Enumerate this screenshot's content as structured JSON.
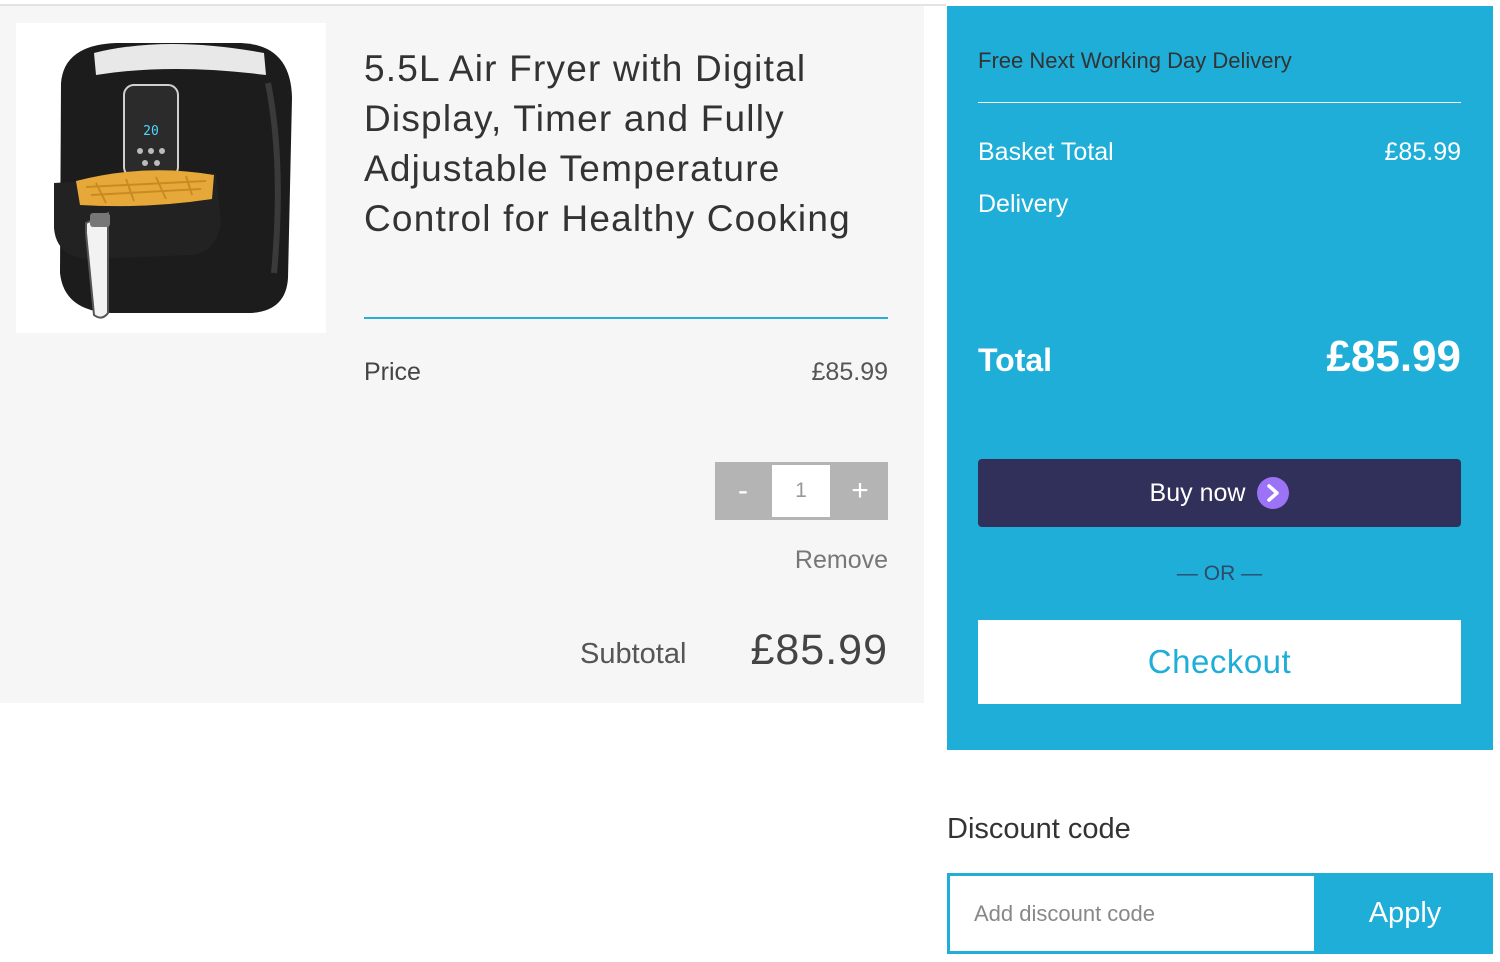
{
  "product": {
    "title": "5.5L Air Fryer with Digital Display, Timer and Fully Adjustable Temperature Control for Healthy Cooking",
    "image_display_text": "20",
    "price_label": "Price",
    "price_value": "£85.99",
    "quantity": "1",
    "minus_label": "-",
    "plus_label": "+",
    "remove_label": "Remove",
    "subtotal_label": "Subtotal",
    "subtotal_value": "£85.99"
  },
  "summary": {
    "delivery_note": "Free Next Working Day Delivery",
    "basket_total_label": "Basket Total",
    "basket_total_value": "£85.99",
    "delivery_label": "Delivery",
    "total_label": "Total",
    "total_value": "£85.99",
    "buy_now_label": "Buy now",
    "buy_now_icon": "chevron-right-icon",
    "or_text": "— OR —",
    "checkout_label": "Checkout"
  },
  "discount": {
    "heading": "Discount code",
    "placeholder": "Add discount code",
    "value": "",
    "apply_label": "Apply"
  },
  "colors": {
    "accent": "#1eaed8",
    "buy_now_bg": "#31305a",
    "buy_now_icon": "#9c72f6",
    "card_bg": "#f6f6f6",
    "stepper_bg": "#b4b4b4"
  }
}
